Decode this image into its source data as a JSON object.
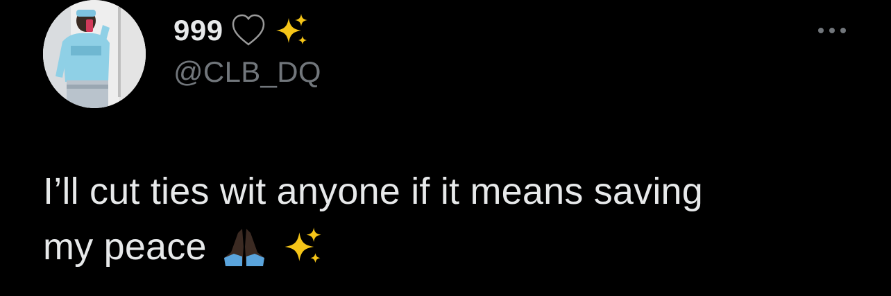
{
  "tweet": {
    "author": {
      "display_name": "999",
      "name_emojis": [
        "black-heart-icon",
        "sparkles-icon"
      ],
      "handle": "@CLB_DQ"
    },
    "text_line1": "I’ll cut ties wit anyone if it means saving",
    "text_line2": "my peace",
    "text_emojis": [
      "folded-hands-icon",
      "sparkles-icon"
    ]
  },
  "colors": {
    "background": "#000000",
    "primary_text": "#e7e9ea",
    "secondary_text": "#71767b",
    "sparkle": "#f5c518"
  }
}
